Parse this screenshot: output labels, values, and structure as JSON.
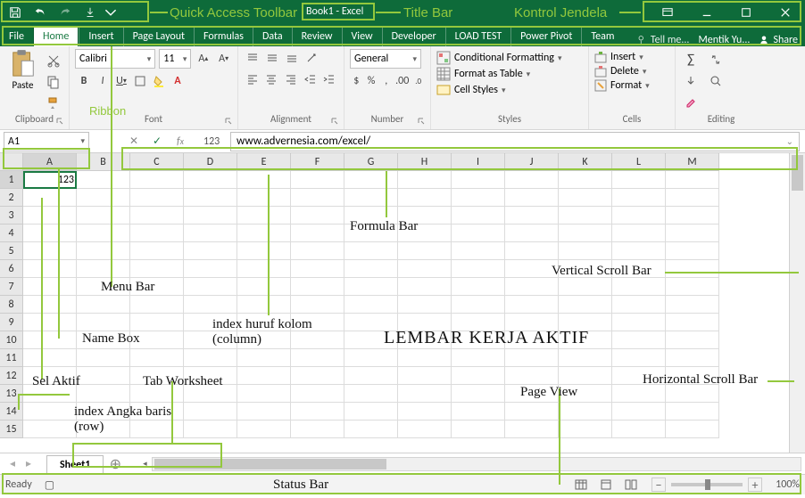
{
  "title": "Book1 - Excel",
  "qat": {
    "icons": [
      "save",
      "undo",
      "redo",
      "touch-mode",
      "customize"
    ]
  },
  "window_controls": [
    "ribbon-options",
    "minimize",
    "maximize",
    "close"
  ],
  "tabs": [
    "File",
    "Home",
    "Insert",
    "Page Layout",
    "Formulas",
    "Data",
    "Review",
    "View",
    "Developer",
    "LOAD TEST",
    "Power Pivot",
    "Team"
  ],
  "tell_me": "Tell me...",
  "account_name": "Mentik Yu...",
  "share": "Share",
  "ribbon": {
    "clipboard": {
      "paste": "Paste",
      "label": "Clipboard"
    },
    "font": {
      "name": "Calibri",
      "size": "11",
      "label": "Font"
    },
    "alignment": {
      "label": "Alignment"
    },
    "number": {
      "format": "General",
      "label": "Number"
    },
    "styles": {
      "conditional": "Conditional Formatting",
      "table": "Format as Table",
      "cell": "Cell Styles",
      "label": "Styles"
    },
    "cells": {
      "insert": "Insert",
      "delete": "Delete",
      "format": "Format",
      "label": "Cells"
    },
    "editing": {
      "label": "Editing"
    }
  },
  "namebox": "A1",
  "formula": "www.advernesia.com/excel/",
  "formula_prefix": "123",
  "columns": [
    "A",
    "B",
    "C",
    "D",
    "E",
    "F",
    "G",
    "H",
    "I",
    "J",
    "K",
    "L",
    "M"
  ],
  "rows": [
    "1",
    "2",
    "3",
    "4",
    "5",
    "6",
    "7",
    "8",
    "9",
    "10",
    "11",
    "12",
    "13",
    "14",
    "15"
  ],
  "active_cell_value": "123",
  "sheet_tab": "Sheet1",
  "status_ready": "Ready",
  "zoom": "100%",
  "annotations": {
    "qat": "Quick Access Toolbar",
    "titlebar": "Title Bar",
    "winctrl": "Kontrol Jendela",
    "menubar": "Menu Bar",
    "ribbon": "Ribbon",
    "namebox": "Name Box",
    "formulabar": "Formula Bar",
    "col_index": "index huruf kolom (column)",
    "row_index": "index Angka baris (row)",
    "sel_aktif": "Sel Aktif",
    "tab_ws": "Tab Worksheet",
    "lembar": "LEMBAR KERJA AKTIF",
    "vscroll": "Vertical Scroll Bar",
    "hscroll": "Horizontal Scroll Bar",
    "pageview": "Page View",
    "statusbar": "Status Bar"
  }
}
